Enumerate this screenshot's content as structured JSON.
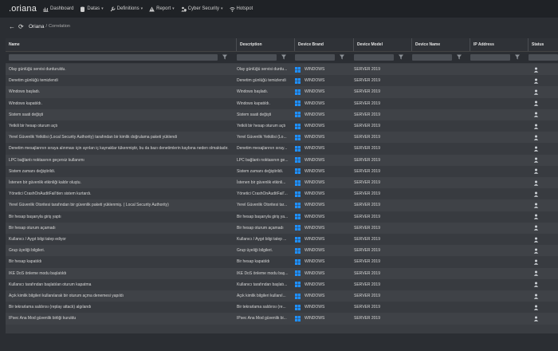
{
  "nav": {
    "logo": ".oriana",
    "items": [
      {
        "label": "Dashboard",
        "icon": "chart-icon",
        "caret": false
      },
      {
        "label": "Datas",
        "icon": "database-icon",
        "caret": true
      },
      {
        "label": "Definitions",
        "icon": "wrench-icon",
        "caret": true
      },
      {
        "label": "Report",
        "icon": "warning-icon",
        "caret": true
      },
      {
        "label": "Cyber Security",
        "icon": "user-shield-icon",
        "caret": true
      },
      {
        "label": "Hotspot",
        "icon": "wifi-icon",
        "caret": false
      }
    ]
  },
  "breadcrumb": {
    "app": "Oriana",
    "separator": "/",
    "page": "Correlation"
  },
  "table": {
    "columns": [
      "Name",
      "Description",
      "Device Brand",
      "Device Model",
      "Device Name",
      "IP Address",
      "Status"
    ],
    "rows": [
      {
        "name": "Olay günlüğü servisi durduruldu.",
        "description": "Olay günlüğü servisi durdu...",
        "brand": "WINDOWS",
        "model": "SERVER 2019"
      },
      {
        "name": "Denetim günlüğü temizlendi",
        "description": "Denetim günlüğü temizlendi",
        "brand": "WINDOWS",
        "model": "SERVER 2019"
      },
      {
        "name": "Windows başladı.",
        "description": "Windows başladı.",
        "brand": "WINDOWS",
        "model": "SERVER 2019"
      },
      {
        "name": "Windows kapatıldı.",
        "description": "Windows kapatıldı.",
        "brand": "WINDOWS",
        "model": "SERVER 2019"
      },
      {
        "name": "Sistem saati değişti",
        "description": "Sistem saati değişti",
        "brand": "WINDOWS",
        "model": "SERVER 2019"
      },
      {
        "name": "Yetkili bir hesap oturum açtı",
        "description": "Yetkili bir hesap oturum açtı",
        "brand": "WINDOWS",
        "model": "SERVER 2019"
      },
      {
        "name": "Yerel Güvenlik Yetkilisi (Local Security Authority) tarafından bir kimlik doğrulama paketi yüklendi",
        "description": "Yerel Güvenlik Yetkilisi (Lo...",
        "brand": "WINDOWS",
        "model": "SERVER 2019"
      },
      {
        "name": "Denetim mesajlarının sıraya alınması için ayrılan iç kaynaklar tükenmiştir, bu da bazı denetimlerin kaybına neden olmaktadır.",
        "description": "Denetim mesajlarının sıray...",
        "brand": "WINDOWS",
        "model": "SERVER 2019"
      },
      {
        "name": "LPC bağlantı noktasının geçersiz kullanımı",
        "description": "LPC bağlantı noktasının ge...",
        "brand": "WINDOWS",
        "model": "SERVER 2019"
      },
      {
        "name": "Sistem zamanı değiştirildi.",
        "description": "Sistem zamanı değiştirildi.",
        "brand": "WINDOWS",
        "model": "SERVER 2019"
      },
      {
        "name": "İstenen bir güvenlik etkinliği kaldır oluştu.",
        "description": "İstenen bir güvenlik etkinli...",
        "brand": "WINDOWS",
        "model": "SERVER 2019"
      },
      {
        "name": "Yönetici CrashOnAuditFail'den sistem kurtardı.",
        "description": "Yönetici CrashOnAuditFail'...",
        "brand": "WINDOWS",
        "model": "SERVER 2019"
      },
      {
        "name": "Yerel Güvenlik Otoritesi tarafından bir güvenlik paketi yüklenmiş. ( Local Security Authority)",
        "description": "Yerel Güvenlik Otoritesi tar...",
        "brand": "WINDOWS",
        "model": "SERVER 2019"
      },
      {
        "name": "Bir hesap başarıyla giriş yaptı",
        "description": "Bir hesap başarıyla giriş ya...",
        "brand": "WINDOWS",
        "model": "SERVER 2019"
      },
      {
        "name": "Bir hesap oturum açamadı",
        "description": "Bir hesap oturum açamadı",
        "brand": "WINDOWS",
        "model": "SERVER 2019"
      },
      {
        "name": "Kullanıcı / Aygıt bilgi talep ediyor",
        "description": "Kullanıcı / Aygıt bilgi talep ...",
        "brand": "WINDOWS",
        "model": "SERVER 2019"
      },
      {
        "name": "Grup üyeliği bilgileri.",
        "description": "Grup üyeliği bilgileri.",
        "brand": "WINDOWS",
        "model": "SERVER 2019"
      },
      {
        "name": "Bir hesap kapatıldı",
        "description": "Bir hesap kapatıldı",
        "brand": "WINDOWS",
        "model": "SERVER 2019"
      },
      {
        "name": "IKE DoS önleme modu başlatıldı",
        "description": "IKE DoS önleme modu baş...",
        "brand": "WINDOWS",
        "model": "SERVER 2019"
      },
      {
        "name": "Kullanıcı tarafından başlatılan oturum kapatma",
        "description": "Kullanıcı tarafından başlatı...",
        "brand": "WINDOWS",
        "model": "SERVER 2019"
      },
      {
        "name": "Açık kimlik bilgileri kullanılarak bir oturum açma denemesi yapıldı",
        "description": "Açık kimlik bilgileri kullanıl...",
        "brand": "WINDOWS",
        "model": "SERVER 2019"
      },
      {
        "name": "Bir tekrarlama saldırısı (replay attack) algılandı",
        "description": "Bir tekrarlama saldırısı (re...",
        "brand": "WINDOWS",
        "model": "SERVER 2019"
      },
      {
        "name": "IPsec Ana Mod güvenlik birliği kuruldu",
        "description": "IPsec Ana Mod güvenlik bi...",
        "brand": "WINDOWS",
        "model": "SERVER 2019"
      }
    ]
  },
  "colors": {
    "windows_blue": "#1e90ff",
    "background": "#2b2e33"
  }
}
